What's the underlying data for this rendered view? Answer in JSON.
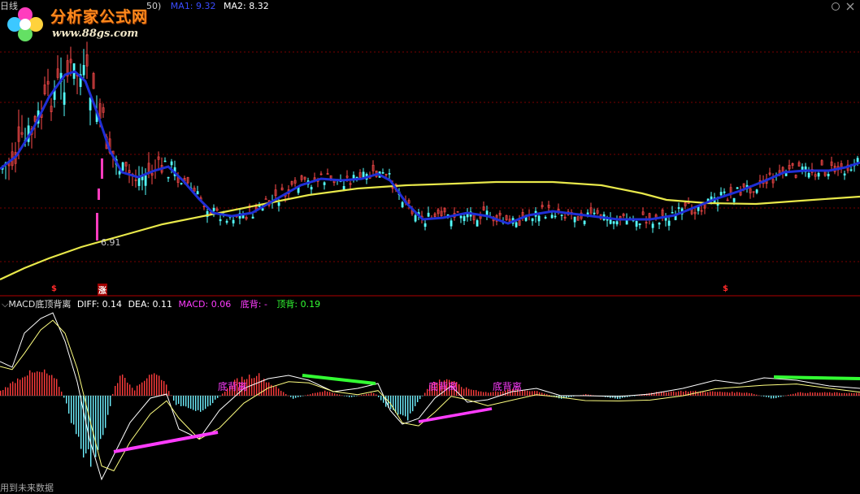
{
  "top_header": {
    "prefix": "日线",
    "ma_period_suffix": "50)",
    "ma1_label": "MA1:",
    "ma1_value": "9.32",
    "ma2_label": "MA2:",
    "ma2_value": "8.32"
  },
  "logo": {
    "title": "分析家公式网",
    "url": "www.88gs.com"
  },
  "top_right_icons": [
    "restore-icon",
    "close-icon"
  ],
  "low_marker": "6.91",
  "signals": [
    {
      "text": "$",
      "color": "#ff2a2a"
    },
    {
      "text": "涨",
      "color": "#ffffff"
    },
    {
      "text": "$",
      "color": "#ff2a2a"
    }
  ],
  "indicator_header": {
    "name": "MACD底顶背离",
    "diff_label": "DIFF:",
    "diff_value": "0.14",
    "dea_label": "DEA:",
    "dea_value": "0.11",
    "macd_label": "MACD:",
    "macd_value": "0.06",
    "bottom_div_label": "底背:",
    "bottom_div_value": "-",
    "top_div_label": "顶背:",
    "top_div_value": "0.19"
  },
  "divergence_labels": [
    "底背离",
    "底背离",
    "底背离"
  ],
  "footer_text": "用到未来数据",
  "colors": {
    "background": "#000000",
    "up_candle": "#ff4b4b",
    "down_candle": "#54ffff",
    "ma1": "#1f2fd6",
    "ma2": "#e8e84a",
    "grid": "#7a0000",
    "divider": "#b00000",
    "macd_pos": "#ff3c3c",
    "macd_neg": "#6ff0ff",
    "bottom_div_line": "#ff3cff",
    "top_div_line": "#33ff33"
  },
  "chart_data": {
    "type": "candlestick_with_macd",
    "price_panel": {
      "series": [
        {
          "name": "MA1",
          "color": "#1f2fd6"
        },
        {
          "name": "MA2",
          "color": "#e8e84a"
        }
      ],
      "annotated_low": 6.91
    },
    "macd_panel": {
      "series": [
        {
          "name": "DIFF",
          "last": 0.14
        },
        {
          "name": "DEA",
          "last": 0.11
        },
        {
          "name": "MACD",
          "last": 0.06
        }
      ],
      "bottom_divergence": "-",
      "top_divergence": 0.19
    }
  }
}
